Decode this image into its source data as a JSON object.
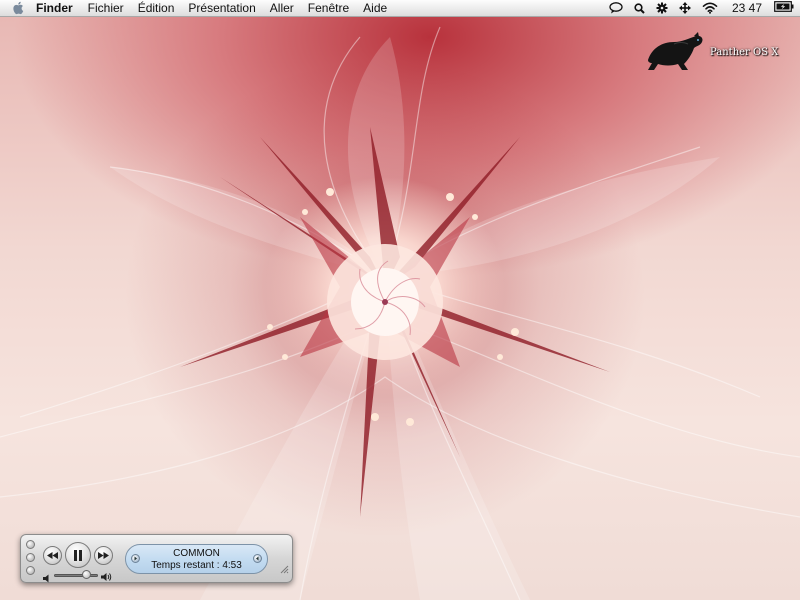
{
  "menubar": {
    "apple_icon": "apple-logo-icon",
    "app_name": "Finder",
    "items": [
      {
        "label": "Fichier"
      },
      {
        "label": "Édition"
      },
      {
        "label": "Présentation"
      },
      {
        "label": "Aller"
      },
      {
        "label": "Fenêtre"
      },
      {
        "label": "Aide"
      }
    ],
    "status_icons": [
      "speech-bubble-icon",
      "spotlight-search-icon",
      "gear-icon",
      "move-arrows-icon",
      "wifi-icon"
    ],
    "clock": "23 47",
    "battery_icon": "battery-charging-icon"
  },
  "desktop": {
    "logo_text": "Panther OS X",
    "colors": {
      "accent": "#b8323c",
      "pale": "#f6e4de"
    }
  },
  "player": {
    "track_title": "COMMON",
    "time_remaining": "Temps restant : 4:53",
    "state": "playing",
    "volume": 0.8
  }
}
